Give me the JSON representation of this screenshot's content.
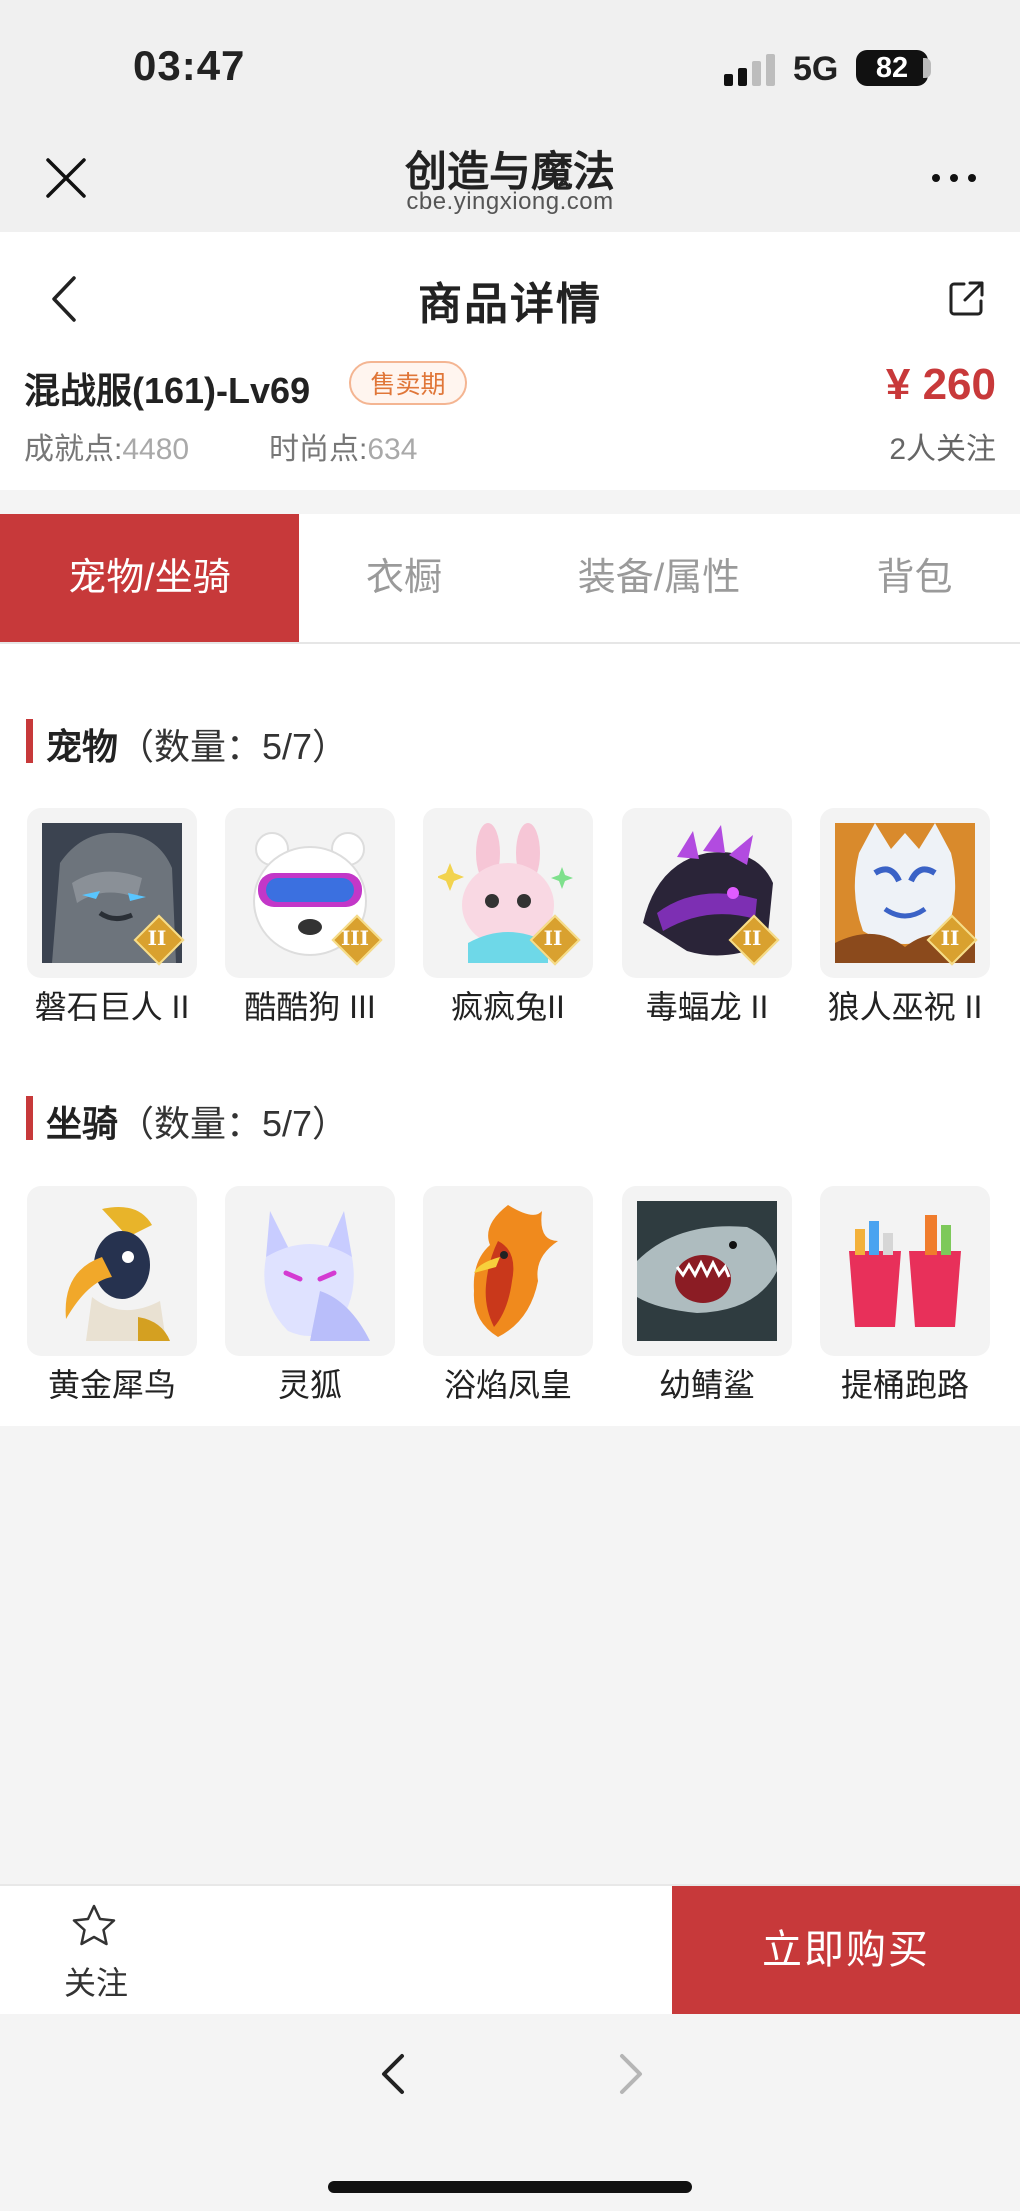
{
  "status_bar": {
    "time": "03:47",
    "network": "5G",
    "battery": "82"
  },
  "web_header": {
    "title": "创造与魔法",
    "domain": "cbe.yingxiong.com"
  },
  "page": {
    "title": "商品详情"
  },
  "product": {
    "server": "混战服(161)-Lv69",
    "badge": "售卖期",
    "price": "¥ 260",
    "watchers": "2人关注",
    "achievement_label": "成就点:",
    "achievement_value": "4480",
    "fashion_label": "时尚点:",
    "fashion_value": "634"
  },
  "tabs": [
    {
      "label": "宠物/坐骑",
      "active": true
    },
    {
      "label": "衣橱",
      "active": false
    },
    {
      "label": "装备/属性",
      "active": false
    },
    {
      "label": "背包",
      "active": false
    }
  ],
  "pets": {
    "title": "宠物",
    "count": "（数量：5/7）",
    "items": [
      {
        "name": "磐石巨人 II",
        "tier": "II",
        "icon": "rock-giant-icon"
      },
      {
        "name": "酷酷狗 III",
        "tier": "III",
        "icon": "cool-dog-icon"
      },
      {
        "name": "疯疯兔II",
        "tier": "II",
        "icon": "crazy-rabbit-icon"
      },
      {
        "name": "毒蝠龙 II",
        "tier": "II",
        "icon": "venom-bat-dragon-icon"
      },
      {
        "name": "狼人巫祝 II",
        "tier": "II",
        "icon": "werewolf-shaman-icon"
      }
    ]
  },
  "mounts": {
    "title": "坐骑",
    "count": "（数量：5/7）",
    "items": [
      {
        "name": "黄金犀鸟",
        "icon": "golden-hornbill-icon"
      },
      {
        "name": "灵狐",
        "icon": "spirit-fox-icon"
      },
      {
        "name": "浴焰凤皇",
        "icon": "flame-phoenix-icon"
      },
      {
        "name": "幼鲭鲨",
        "icon": "young-shark-icon"
      },
      {
        "name": "提桶跑路",
        "icon": "bucket-run-icon"
      }
    ]
  },
  "bottom_bar": {
    "favorite_label": "关注",
    "buy_label": "立即购买"
  },
  "colors": {
    "accent": "#c7393a",
    "badge": "#e07638",
    "tier": "#d9a12f"
  }
}
